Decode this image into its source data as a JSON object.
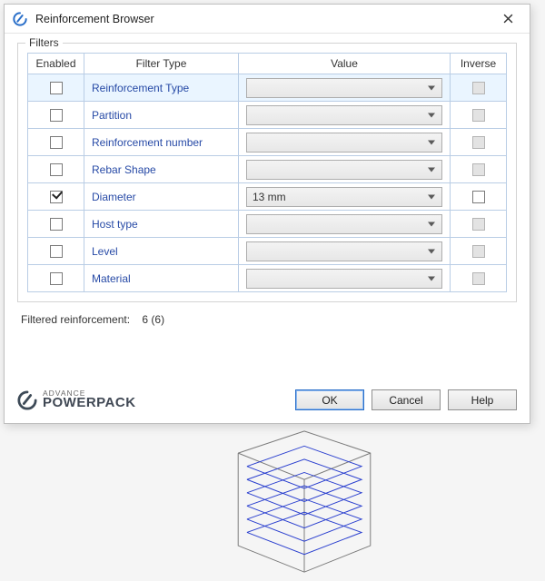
{
  "window": {
    "title": "Reinforcement Browser"
  },
  "filters": {
    "group_label": "Filters",
    "headers": {
      "enabled": "Enabled",
      "type": "Filter Type",
      "value": "Value",
      "inverse": "Inverse"
    },
    "rows": [
      {
        "label": "Reinforcement Type",
        "enabled": false,
        "value": "",
        "inverse_enabled": false,
        "selected": true
      },
      {
        "label": "Partition",
        "enabled": false,
        "value": "",
        "inverse_enabled": false,
        "selected": false
      },
      {
        "label": "Reinforcement number",
        "enabled": false,
        "value": "",
        "inverse_enabled": false,
        "selected": false
      },
      {
        "label": "Rebar Shape",
        "enabled": false,
        "value": "",
        "inverse_enabled": false,
        "selected": false
      },
      {
        "label": "Diameter",
        "enabled": true,
        "value": "13 mm",
        "inverse_enabled": true,
        "selected": false
      },
      {
        "label": "Host type",
        "enabled": false,
        "value": "",
        "inverse_enabled": false,
        "selected": false
      },
      {
        "label": "Level",
        "enabled": false,
        "value": "",
        "inverse_enabled": false,
        "selected": false
      },
      {
        "label": "Material",
        "enabled": false,
        "value": "",
        "inverse_enabled": false,
        "selected": false
      }
    ]
  },
  "summary": {
    "label": "Filtered reinforcement:",
    "count_text": "6 (6)"
  },
  "brand": {
    "small": "ADVANCE",
    "large": "POWERPACK"
  },
  "buttons": {
    "ok": "OK",
    "cancel": "Cancel",
    "help": "Help"
  }
}
